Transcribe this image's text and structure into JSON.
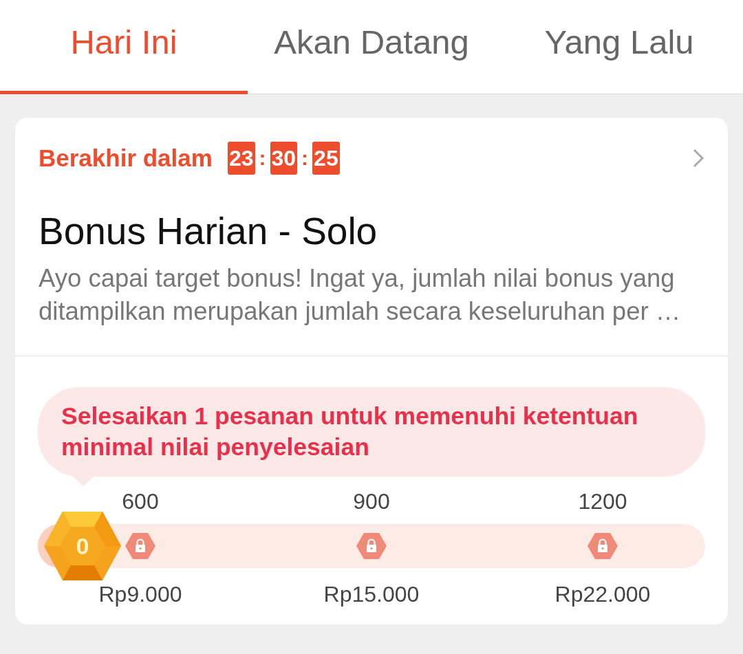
{
  "tabs": [
    {
      "label": "Hari Ini",
      "selected": true
    },
    {
      "label": "Akan Datang",
      "selected": false
    },
    {
      "label": "Yang Lalu",
      "selected": false
    }
  ],
  "card": {
    "countdown_label": "Berakhir dalam",
    "timer": [
      {
        "kind": "digits",
        "text": "23"
      },
      {
        "kind": "separator",
        "text": ":"
      },
      {
        "kind": "digits",
        "text": "30"
      },
      {
        "kind": "separator",
        "text": ":"
      },
      {
        "kind": "digits",
        "text": "25"
      }
    ],
    "title": "Bonus Harian - Solo",
    "description": "Ayo capai target bonus! Ingat ya, jumlah nilai bonus yang ditampilkan merupakan jumlah secara keseluruhan per …",
    "tip": "Selesaikan 1 pesanan untuk memenuhi ketentuan minimal nilai penyelesaian",
    "progress": {
      "badge": "0",
      "level": 0
    },
    "milestones": [
      {
        "target": "600",
        "reward": "Rp9.000",
        "locked": true
      },
      {
        "target": "900",
        "reward": "Rp15.000",
        "locked": true
      },
      {
        "target": "1200",
        "reward": "Rp22.000",
        "locked": true
      }
    ]
  }
}
